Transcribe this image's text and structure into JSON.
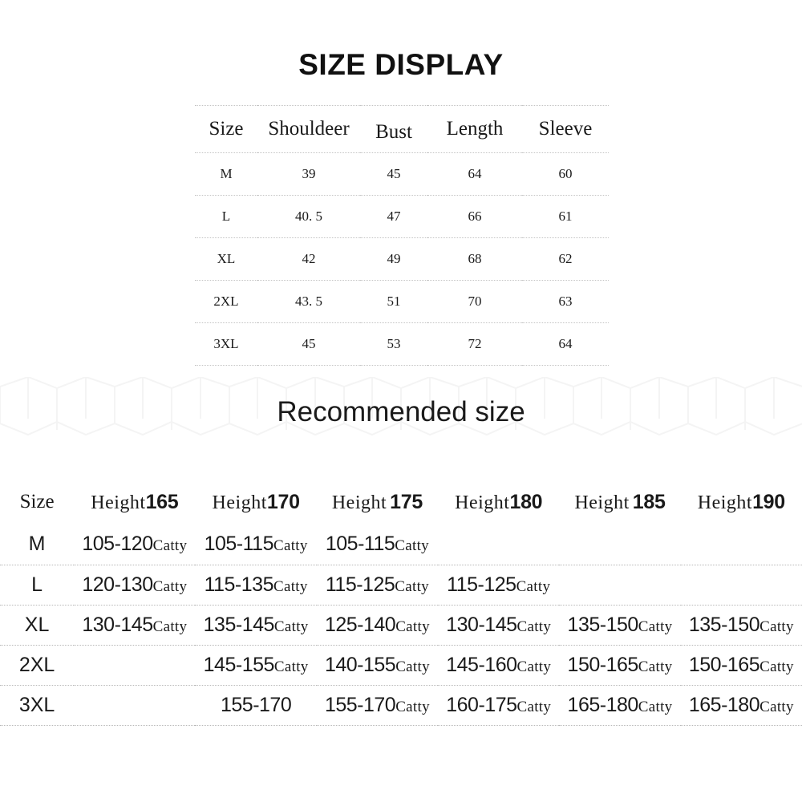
{
  "title": "SIZE DISPLAY",
  "recommended_title": "Recommended size",
  "colors": {
    "text": "#1a1a1a",
    "rule": "#c4c4c4",
    "background": "#ffffff",
    "watermark": "#f6f6f6"
  },
  "size_table": {
    "headers": [
      "Size",
      "Shouldeer",
      "Bust",
      "Length",
      "Sleeve"
    ],
    "rows": [
      {
        "size": "M",
        "shoulder": "39",
        "bust": "45",
        "length": "64",
        "sleeve": "60"
      },
      {
        "size": "L",
        "shoulder": "40. 5",
        "bust": "47",
        "length": "66",
        "sleeve": "61"
      },
      {
        "size": "XL",
        "shoulder": "42",
        "bust": "49",
        "length": "68",
        "sleeve": "62"
      },
      {
        "size": "2XL",
        "shoulder": "43. 5",
        "bust": "51",
        "length": "70",
        "sleeve": "63"
      },
      {
        "size": "3XL",
        "shoulder": "45",
        "bust": "53",
        "length": "72",
        "sleeve": "64"
      }
    ]
  },
  "recommended_table": {
    "size_header": "Size",
    "height_word": "Height",
    "unit": "Catty",
    "height_headers": [
      "165",
      "170",
      "175",
      "180",
      "185",
      "190"
    ],
    "rows": [
      {
        "size": "M",
        "values": [
          {
            "range": "105-120",
            "unit": "Catty"
          },
          {
            "range": "105-115",
            "unit": "Catty"
          },
          {
            "range": "105-115",
            "unit": "Catty"
          },
          {
            "range": "",
            "unit": ""
          },
          {
            "range": "",
            "unit": ""
          },
          {
            "range": "",
            "unit": ""
          }
        ]
      },
      {
        "size": "L",
        "values": [
          {
            "range": "120-130",
            "unit": "Catty"
          },
          {
            "range": "115-135",
            "unit": "Catty"
          },
          {
            "range": "115-125",
            "unit": "Catty"
          },
          {
            "range": "115-125",
            "unit": "Catty"
          },
          {
            "range": "",
            "unit": ""
          },
          {
            "range": "",
            "unit": ""
          }
        ]
      },
      {
        "size": "XL",
        "values": [
          {
            "range": "130-145",
            "unit": "Catty"
          },
          {
            "range": "135-145",
            "unit": "Catty"
          },
          {
            "range": "125-140",
            "unit": "Catty"
          },
          {
            "range": "130-145",
            "unit": "Catty"
          },
          {
            "range": "135-150",
            "unit": "Catty"
          },
          {
            "range": "135-150",
            "unit": "Catty"
          }
        ]
      },
      {
        "size": "2XL",
        "values": [
          {
            "range": "",
            "unit": ""
          },
          {
            "range": "145-155",
            "unit": "Catty"
          },
          {
            "range": "140-155",
            "unit": "Catty"
          },
          {
            "range": "145-160",
            "unit": "Catty"
          },
          {
            "range": "150-165",
            "unit": "Catty"
          },
          {
            "range": "150-165",
            "unit": "Catty"
          }
        ]
      },
      {
        "size": "3XL",
        "values": [
          {
            "range": "",
            "unit": ""
          },
          {
            "range": "155-170",
            "unit": ""
          },
          {
            "range": "155-170",
            "unit": "Catty"
          },
          {
            "range": "160-175",
            "unit": "Catty"
          },
          {
            "range": "165-180",
            "unit": "Catty"
          },
          {
            "range": "165-180",
            "unit": "Catty"
          }
        ]
      }
    ]
  }
}
